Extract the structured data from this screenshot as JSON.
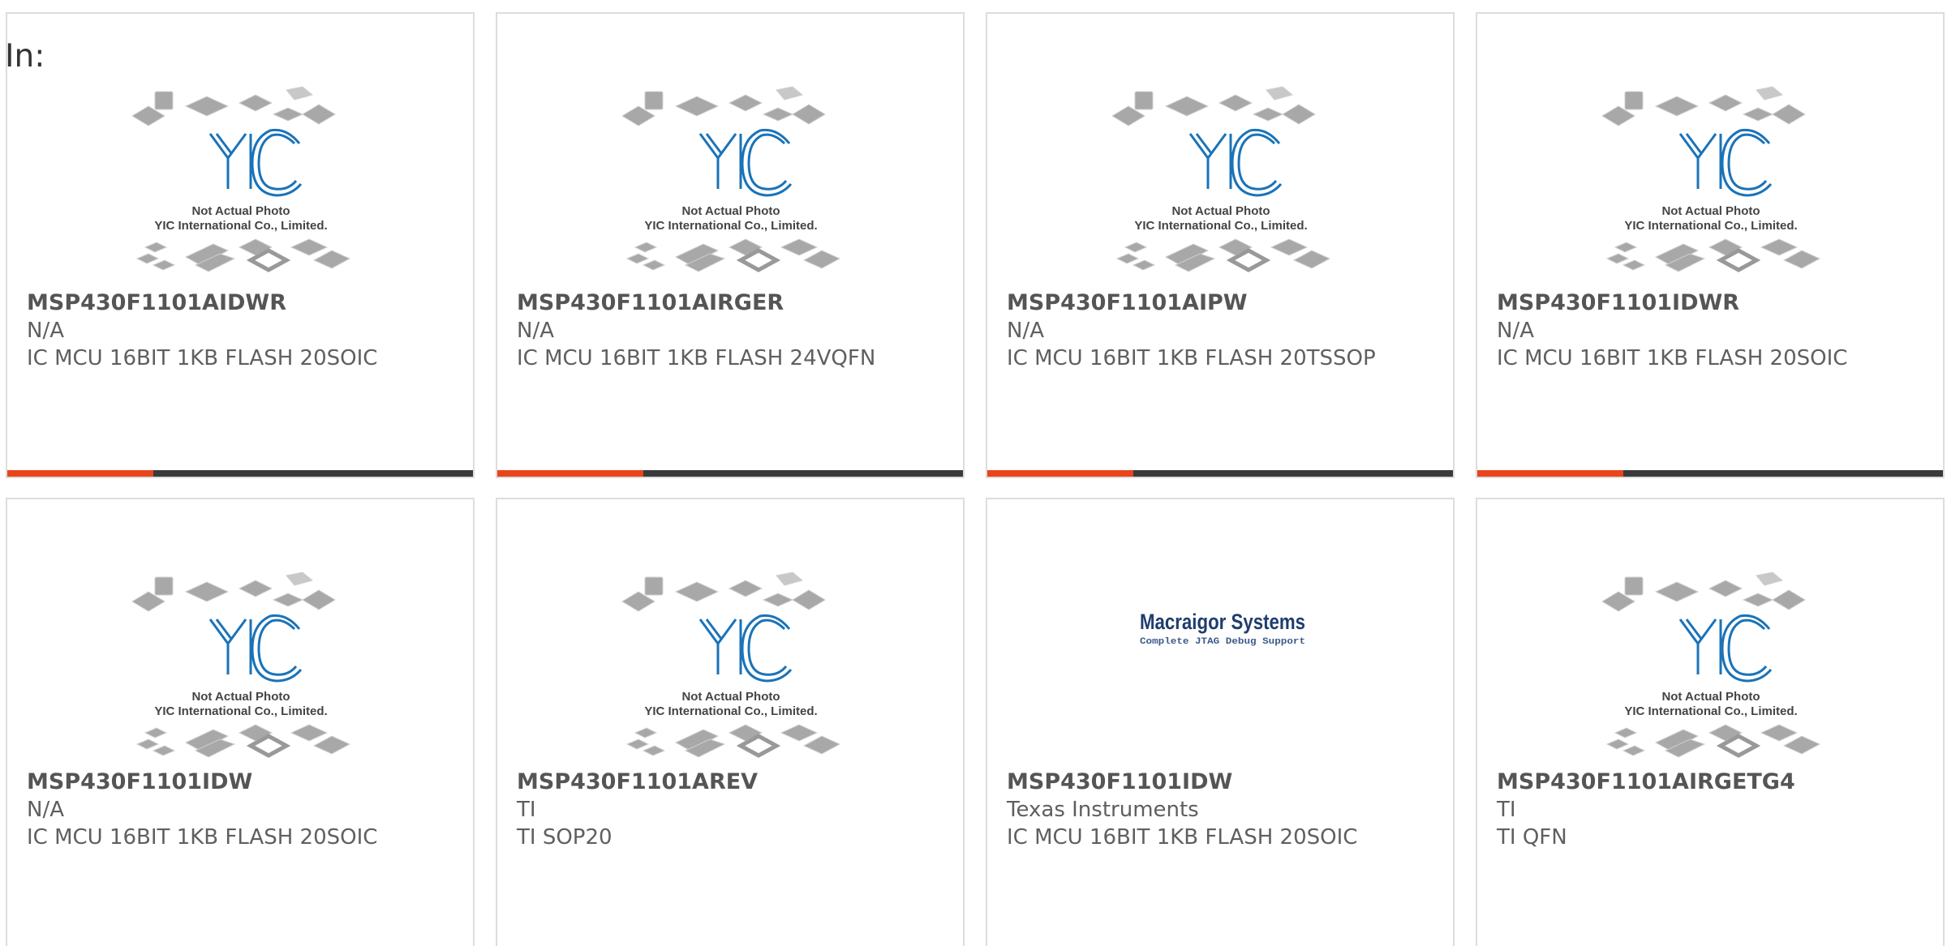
{
  "header": {
    "in_label": "In:"
  },
  "placeholder_image": {
    "line1": "Not Actual Photo",
    "line2": "YIC International Co., Limited.",
    "logo_text": "YIC"
  },
  "macraigor_image": {
    "title": "Macraigor Systems",
    "tagline": "Complete JTAG Debug Support"
  },
  "colors": {
    "accent": "#e8451d",
    "bar_dark": "#3a3a3a",
    "logo_blue": "#1a73b8"
  },
  "products": [
    {
      "part": "MSP430F1101AIDWR",
      "manufacturer": "N/A",
      "description": "IC MCU 16BIT 1KB FLASH 20SOIC",
      "image": "yic-placeholder"
    },
    {
      "part": "MSP430F1101AIRGER",
      "manufacturer": "N/A",
      "description": "IC MCU 16BIT 1KB FLASH 24VQFN",
      "image": "yic-placeholder"
    },
    {
      "part": "MSP430F1101AIPW",
      "manufacturer": "N/A",
      "description": "IC MCU 16BIT 1KB FLASH 20TSSOP",
      "image": "yic-placeholder"
    },
    {
      "part": "MSP430F1101IDWR",
      "manufacturer": "N/A",
      "description": "IC MCU 16BIT 1KB FLASH 20SOIC",
      "image": "yic-placeholder"
    },
    {
      "part": "MSP430F1101IDW",
      "manufacturer": "N/A",
      "description": "IC MCU 16BIT 1KB FLASH 20SOIC",
      "image": "yic-placeholder"
    },
    {
      "part": "MSP430F1101AREV",
      "manufacturer": "TI",
      "description": "TI SOP20",
      "image": "yic-placeholder"
    },
    {
      "part": "MSP430F1101IDW",
      "manufacturer": "Texas Instruments",
      "description": "IC MCU 16BIT 1KB FLASH 20SOIC",
      "image": "macraigor-logo"
    },
    {
      "part": "MSP430F1101AIRGETG4",
      "manufacturer": "TI",
      "description": "TI QFN",
      "image": "yic-placeholder"
    }
  ]
}
